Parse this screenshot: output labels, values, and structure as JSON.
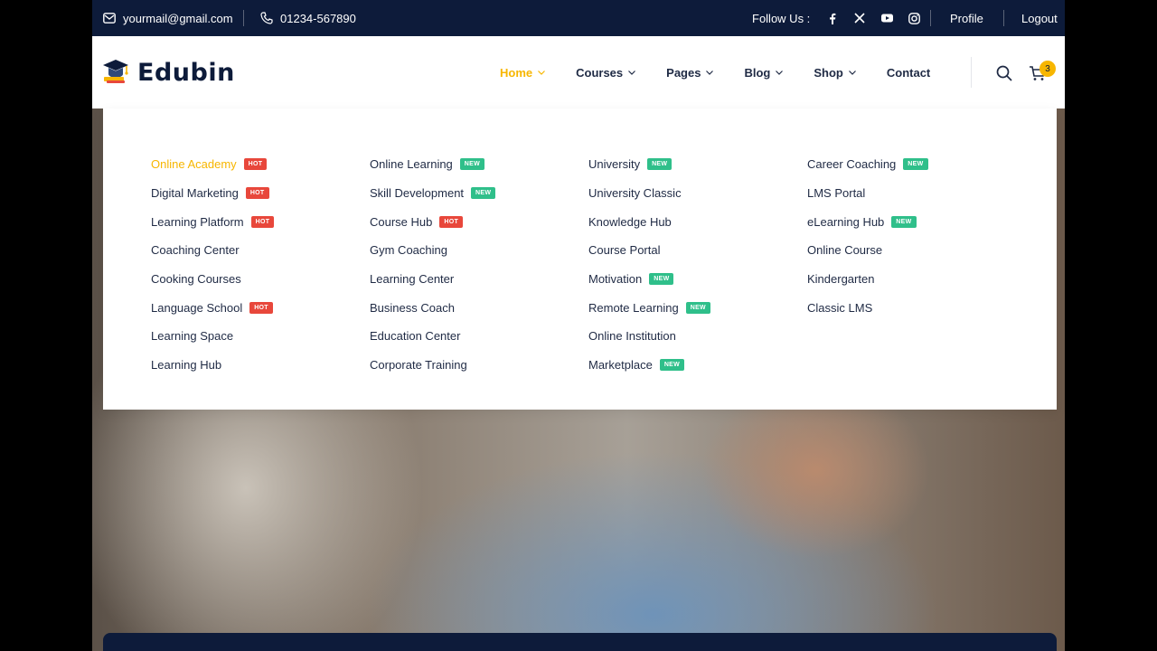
{
  "topbar": {
    "email": "yourmail@gmail.com",
    "phone": "01234-567890",
    "follow_label": "Follow Us :",
    "social_icons": [
      "facebook-icon",
      "x-icon",
      "youtube-icon",
      "instagram-icon"
    ],
    "profile": "Profile",
    "logout": "Logout"
  },
  "header": {
    "logo_text": "Edubin",
    "nav": [
      "Home",
      "Courses",
      "Pages",
      "Blog",
      "Shop",
      "Contact"
    ],
    "active_nav": "Home",
    "cart_count": "3"
  },
  "mega_menu": {
    "columns": [
      [
        {
          "label": "Online Academy",
          "badge": "HOT",
          "active": true
        },
        {
          "label": "Digital Marketing",
          "badge": "HOT"
        },
        {
          "label": "Learning Platform",
          "badge": "HOT"
        },
        {
          "label": "Coaching Center",
          "badge": ""
        },
        {
          "label": "Cooking Courses",
          "badge": ""
        },
        {
          "label": "Language School",
          "badge": "HOT"
        },
        {
          "label": "Learning Space",
          "badge": ""
        },
        {
          "label": "Learning Hub",
          "badge": ""
        }
      ],
      [
        {
          "label": "Online Learning",
          "badge": "NEW"
        },
        {
          "label": "Skill Development",
          "badge": "NEW"
        },
        {
          "label": "Course Hub",
          "badge": "HOT"
        },
        {
          "label": "Gym Coaching",
          "badge": ""
        },
        {
          "label": "Learning Center",
          "badge": ""
        },
        {
          "label": "Business Coach",
          "badge": ""
        },
        {
          "label": "Education Center",
          "badge": ""
        },
        {
          "label": "Corporate Training",
          "badge": ""
        }
      ],
      [
        {
          "label": "University",
          "badge": "NEW"
        },
        {
          "label": "University Classic",
          "badge": ""
        },
        {
          "label": "Knowledge Hub",
          "badge": ""
        },
        {
          "label": "Course Portal",
          "badge": ""
        },
        {
          "label": "Motivation",
          "badge": "NEW"
        },
        {
          "label": "Remote Learning",
          "badge": "NEW"
        },
        {
          "label": "Online Institution",
          "badge": ""
        },
        {
          "label": "Marketplace",
          "badge": "NEW"
        }
      ],
      [
        {
          "label": "Career Coaching",
          "badge": "NEW"
        },
        {
          "label": "LMS Portal",
          "badge": ""
        },
        {
          "label": "eLearning Hub",
          "badge": "NEW"
        },
        {
          "label": "Online Course",
          "badge": ""
        },
        {
          "label": "Kindergarten",
          "badge": ""
        },
        {
          "label": "Classic LMS",
          "badge": ""
        }
      ]
    ]
  },
  "colors": {
    "topbar_bg": "#0d1b3a",
    "accent": "#f7b600",
    "hot_badge": "#e8473b",
    "new_badge": "#2fbf8a",
    "text": "#1f2a44"
  }
}
